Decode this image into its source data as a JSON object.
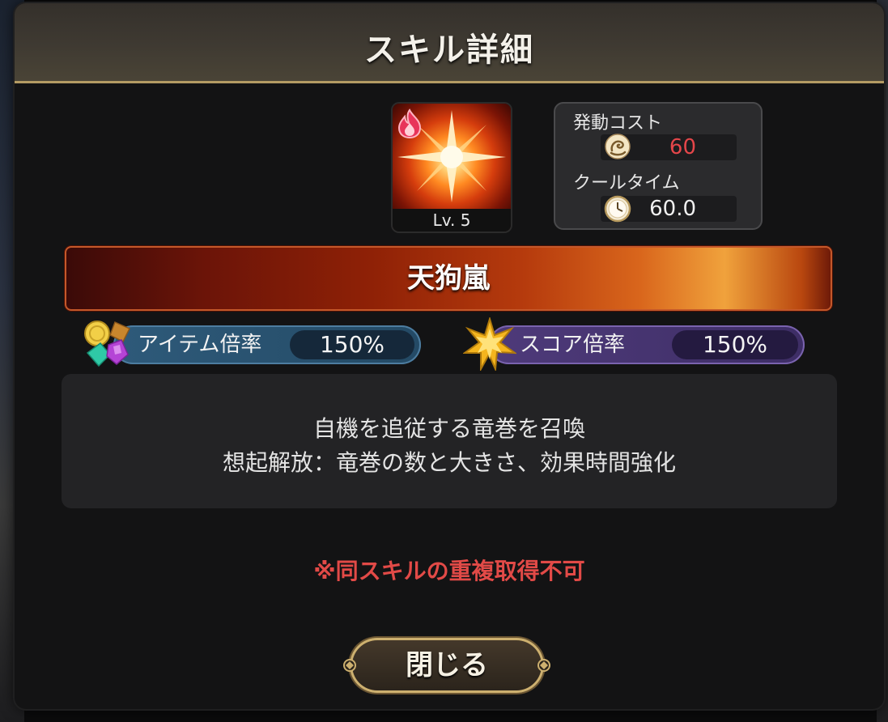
{
  "dialog": {
    "title": "スキル詳細"
  },
  "skill": {
    "icon": "fire-starburst-icon",
    "element_icon": "fire-element-icon",
    "level_label": "Lv. 5",
    "name": "天狗嵐"
  },
  "cost_panel": {
    "activation_cost_label": "発動コスト",
    "activation_cost_value": "60",
    "activation_cost_icon": "swirl-energy-icon",
    "activation_cost_color": "#e5464a",
    "cooltime_label": "クールタイム",
    "cooltime_value": "60.0",
    "cooltime_icon": "clock-icon"
  },
  "multipliers": {
    "item": {
      "label": "アイテム倍率",
      "value": "150%",
      "icon": "gems-coins-icon",
      "color": "#2e5a7a"
    },
    "score": {
      "label": "スコア倍率",
      "value": "150%",
      "icon": "gold-star-icon",
      "color": "#4e3a7a"
    }
  },
  "description": {
    "line1": "自機を追従する竜巻を召喚",
    "line2": "想起解放：竜巻の数と大きさ、効果時間強化"
  },
  "warning": "※同スキルの重複取得不可",
  "close_button": {
    "label": "閉じる"
  }
}
